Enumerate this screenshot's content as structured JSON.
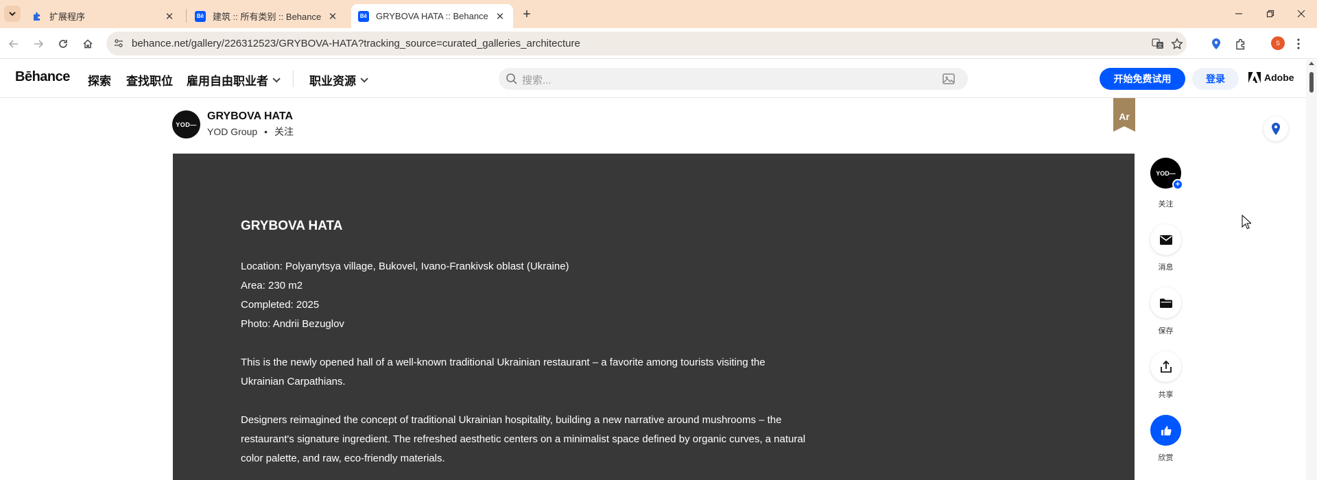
{
  "browser": {
    "tabs": [
      {
        "title": "扩展程序",
        "active": false,
        "favicon": "puzzle-icon"
      },
      {
        "title": "建筑 :: 所有类别 :: Behance",
        "active": false,
        "favicon": "Bē"
      },
      {
        "title": "GRYBOVA HATA :: Behance",
        "active": true,
        "favicon": "Bē"
      }
    ],
    "url": "behance.net/gallery/226312523/GRYBOVA-HATA?tracking_source=curated_galleries_architecture",
    "profile_initial": "S"
  },
  "header": {
    "logo": "Bēhance",
    "nav": [
      "探索",
      "查找职位",
      "雇用自由职业者",
      "职业资源"
    ],
    "search_placeholder": "搜索...",
    "trial_button": "开始免费试用",
    "login_button": "登录",
    "adobe_label": "Adobe"
  },
  "project": {
    "title": "GRYBOVA HATA",
    "owner": "YOD Group",
    "separator": "•",
    "follow": "关注",
    "avatar_text": "YOD—",
    "badge": "Ar",
    "content": {
      "heading": "GRYBOVA HATA",
      "location": "Location:  Polyanytsya village, Bukovel, Ivano-Frankivsk oblast (Ukraine)",
      "area": "Area:  230 m2",
      "completed": "Completed: 2025",
      "photo": "Photo: Andrii Bezuglov",
      "para1": "This is the newly opened hall of a well-known traditional Ukrainian restaurant – a favorite among tourists visiting the Ukrainian Carpathians.",
      "para2": "Designers reimagined the concept of traditional Ukrainian hospitality, building a new narrative around mushrooms – the restaurant's signature ingredient. The refreshed aesthetic centers on a minimalist space defined by organic curves, a natural color palette, and raw, eco-friendly materials."
    }
  },
  "rail": {
    "follow": "关注",
    "message": "消息",
    "save": "保存",
    "share": "共享",
    "appreciate": "欣赏"
  },
  "colors": {
    "brand_blue": "#0057ff",
    "tab_strip": "#fbe0c9",
    "content_bg": "#383838",
    "badge": "#a3865c"
  }
}
